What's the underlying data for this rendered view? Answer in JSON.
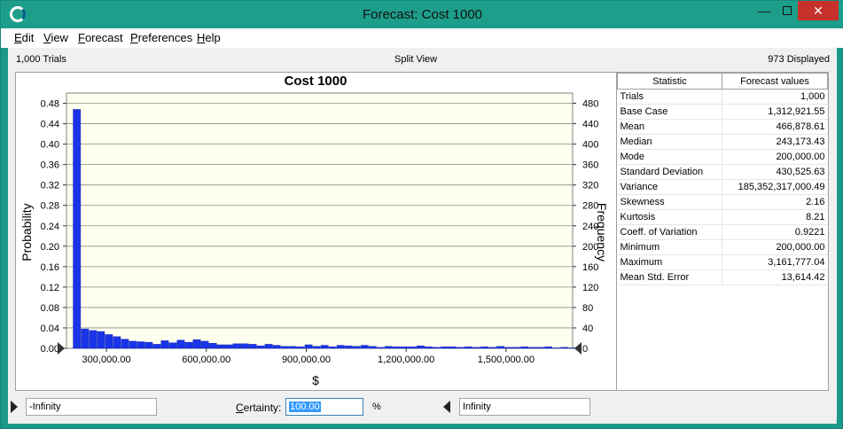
{
  "window": {
    "title": "Forecast: Cost 1000",
    "minimize_glyph": "—",
    "close_glyph": "✕"
  },
  "menu": [
    {
      "label": "Edit",
      "mnemonic": "E",
      "rest": "dit"
    },
    {
      "label": "View",
      "mnemonic": "V",
      "rest": "iew"
    },
    {
      "label": "Forecast",
      "mnemonic": "F",
      "rest": "orecast"
    },
    {
      "label": "Preferences",
      "mnemonic": "P",
      "rest": "references"
    },
    {
      "label": "Help",
      "mnemonic": "H",
      "rest": "elp"
    }
  ],
  "info": {
    "trials": "1,000 Trials",
    "view": "Split View",
    "displayed": "973 Displayed"
  },
  "chart_data": {
    "type": "bar",
    "title": "Cost 1000",
    "xlabel": "$",
    "ylabel": "Probability",
    "y2label": "Frequency",
    "x_ticks": [
      "300,000.00",
      "600,000.00",
      "900,000.00",
      "1,200,000.00",
      "1,500,000.00"
    ],
    "x_tick_values": [
      300000,
      600000,
      900000,
      1200000,
      1500000
    ],
    "xlim": [
      180000,
      1700000
    ],
    "y_ticks": [
      "0.00",
      "0.04",
      "0.08",
      "0.12",
      "0.16",
      "0.20",
      "0.24",
      "0.28",
      "0.32",
      "0.36",
      "0.40",
      "0.44",
      "0.48"
    ],
    "y2_ticks": [
      "0",
      "40",
      "80",
      "120",
      "160",
      "200",
      "240",
      "280",
      "320",
      "360",
      "400",
      "440",
      "480"
    ],
    "ylim": [
      0,
      0.5
    ],
    "bin_start": 200000,
    "bin_width": 24000,
    "values": [
      0.468,
      0.038,
      0.035,
      0.033,
      0.027,
      0.023,
      0.018,
      0.014,
      0.013,
      0.012,
      0.008,
      0.015,
      0.011,
      0.016,
      0.012,
      0.017,
      0.014,
      0.01,
      0.007,
      0.007,
      0.009,
      0.009,
      0.008,
      0.005,
      0.008,
      0.006,
      0.004,
      0.004,
      0.003,
      0.007,
      0.004,
      0.006,
      0.003,
      0.006,
      0.005,
      0.004,
      0.006,
      0.004,
      0.002,
      0.004,
      0.003,
      0.003,
      0.003,
      0.005,
      0.003,
      0.002,
      0.003,
      0.003,
      0.002,
      0.003,
      0.002,
      0.003,
      0.002,
      0.004,
      0.002,
      0.002,
      0.003,
      0.002,
      0.002,
      0.003,
      0.001,
      0.002,
      0.001
    ],
    "bar_color": "#1a35e8",
    "plot_bg": "#fffff0",
    "grid": "horizontal"
  },
  "stats": {
    "header": [
      "Statistic",
      "Forecast values"
    ],
    "rows": [
      {
        "name": "Trials",
        "value": "1,000"
      },
      {
        "name": "Base Case",
        "value": "1,312,921.55"
      },
      {
        "name": "Mean",
        "value": "466,878.61"
      },
      {
        "name": "Median",
        "value": "243,173.43"
      },
      {
        "name": "Mode",
        "value": "200,000.00"
      },
      {
        "name": "Standard Deviation",
        "value": "430,525.63"
      },
      {
        "name": "Variance",
        "value": "185,352,317,000.49"
      },
      {
        "name": "Skewness",
        "value": "2.16"
      },
      {
        "name": "Kurtosis",
        "value": "8.21"
      },
      {
        "name": "Coeff. of Variation",
        "value": "0.9221"
      },
      {
        "name": "Minimum",
        "value": "200,000.00"
      },
      {
        "name": "Maximum",
        "value": "3,161,777.04"
      },
      {
        "name": "Mean Std. Error",
        "value": "13,614.42"
      }
    ]
  },
  "certainty": {
    "left_value": "-Infinity",
    "label": "Certainty:",
    "label_mnemonic": "C",
    "label_rest": "ertainty:",
    "value": "100.00",
    "unit": "%",
    "right_value": "Infinity"
  },
  "colors": {
    "titlebar": "#1d9e8b",
    "close_button": "#c7312b"
  }
}
